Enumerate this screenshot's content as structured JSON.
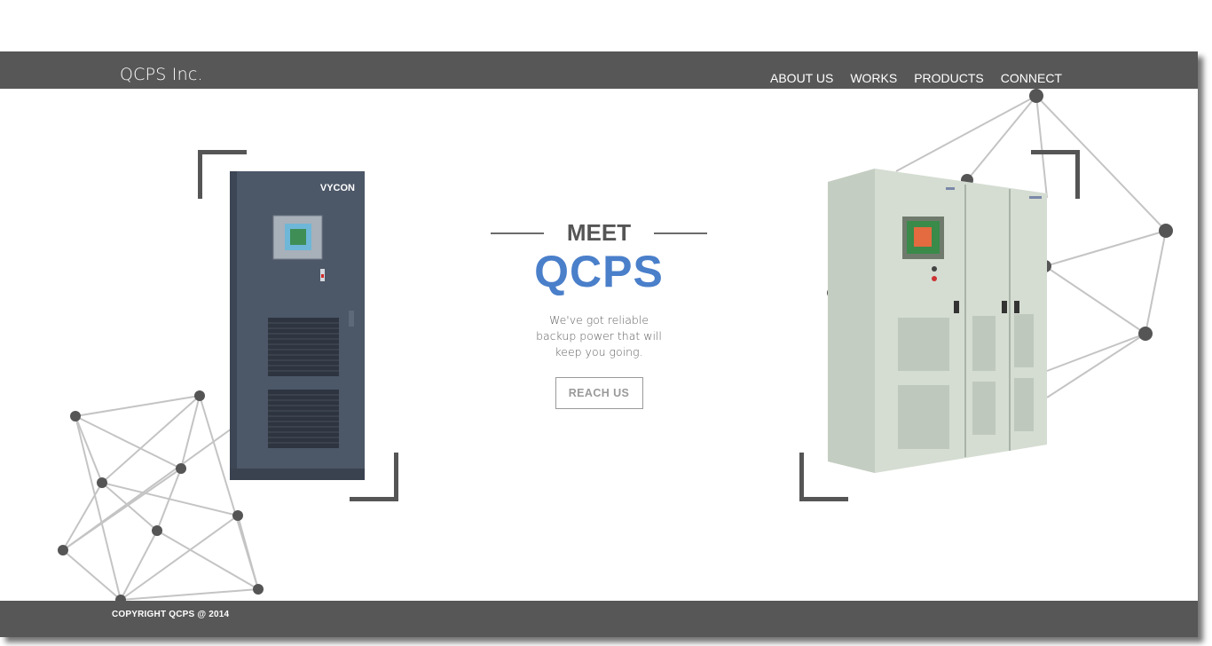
{
  "header": {
    "brand": "QCPS Inc.",
    "nav": [
      {
        "label": "ABOUT US"
      },
      {
        "label": "WORKS"
      },
      {
        "label": "PRODUCTS"
      },
      {
        "label": "CONNECT"
      }
    ]
  },
  "hero": {
    "meet": "MEET",
    "title": "QCPS",
    "tagline": "We've got reliable backup power that will keep you going.",
    "cta_label": "REACH US"
  },
  "products": {
    "left_brand": "VYCON"
  },
  "footer": {
    "copyright": "COPYRIGHT QCPS @ 2014"
  },
  "colors": {
    "bar": "#575757",
    "accent": "#4a7fca",
    "cabinet_left": "#4c5767",
    "cabinet_right": "#d9e2d6"
  }
}
